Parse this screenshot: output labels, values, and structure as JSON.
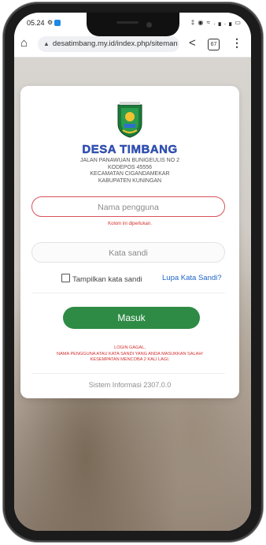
{
  "statusbar": {
    "time": "05.24",
    "left_icons": "⚙",
    "right_icons": "‡ ◉ ≈ .▗ .▗ ▭"
  },
  "browser": {
    "url": "desatimbang.my.id/index.php/siteman",
    "tab_count": "67"
  },
  "login": {
    "brand": "DESA TIMBANG",
    "address_lines": [
      "JALAN PANAWUAN BUNIGEULIS NO 2",
      "KODEPOS 45556",
      "KECAMATAN CIGANDAMEKAR",
      "KABUPATEN KUNINGAN"
    ],
    "username_placeholder": "Nama pengguna",
    "username_error": "Kolom ini diperlukan.",
    "password_placeholder": "Kata sandi",
    "show_password_label": "Tampilkan kata sandi",
    "forgot_password_label": "Lupa Kata Sandi?",
    "submit_label": "Masuk",
    "error_lines": [
      "LOGIN GAGAL,",
      "NAMA PENGGUNA ATAU KATA SANDI YANG ANDA MASUKKAN SALAH!",
      "KESEMPATAN MENCOBA 2 KALI LAGI."
    ],
    "footer": "Sistem Informasi 2307.0.0"
  },
  "colors": {
    "primary_button": "#2e8b45",
    "brand_text": "#2f56c7",
    "error": "#d32f2f",
    "link": "#1e66c6"
  }
}
